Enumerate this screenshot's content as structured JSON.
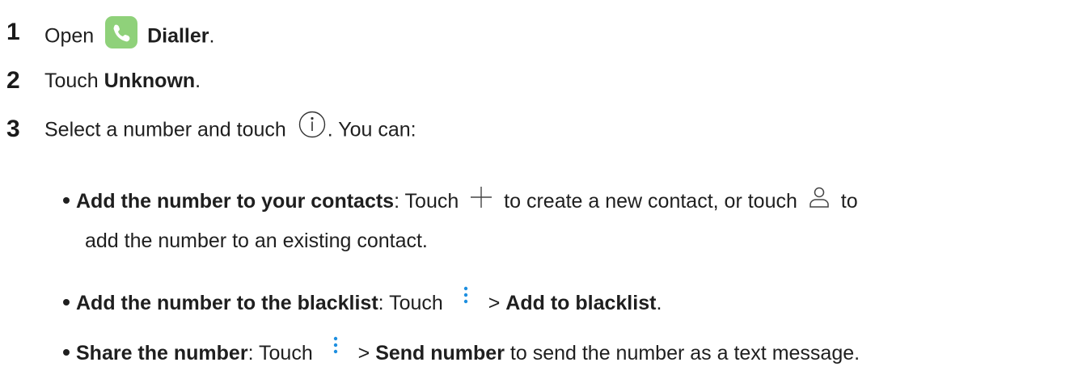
{
  "steps": [
    {
      "number": "1",
      "prefix": "Open",
      "app_name": "Dialler",
      "suffix": ".",
      "icon": "phone-app-icon"
    },
    {
      "number": "2",
      "prefix": "Touch",
      "target": "Unknown",
      "suffix": "."
    },
    {
      "number": "3",
      "prefix": "Select a number and touch",
      "icon": "info-icon",
      "suffix": ". You can:"
    }
  ],
  "options": [
    {
      "title": "Add the number to your contacts",
      "colon": ":",
      "text1": " Touch",
      "icon1": "plus-icon",
      "text2": "to create a new contact, or touch",
      "icon2": "contact-icon",
      "text3": "to",
      "line2": "add the number to an existing contact."
    },
    {
      "title": "Add the number to the blacklist",
      "colon": ":",
      "text1": " Touch",
      "icon": "more-icon",
      "gt": ">",
      "action": "Add to blacklist",
      "suffix": "."
    },
    {
      "title": "Share the number",
      "colon": ":",
      "text1": " Touch",
      "icon": "more-icon",
      "gt": ">",
      "action": "Send number",
      "suffix": " to send the number as a text message."
    }
  ],
  "colors": {
    "app_icon": "#8fd17a",
    "more_icon": "#1e8fe0"
  }
}
